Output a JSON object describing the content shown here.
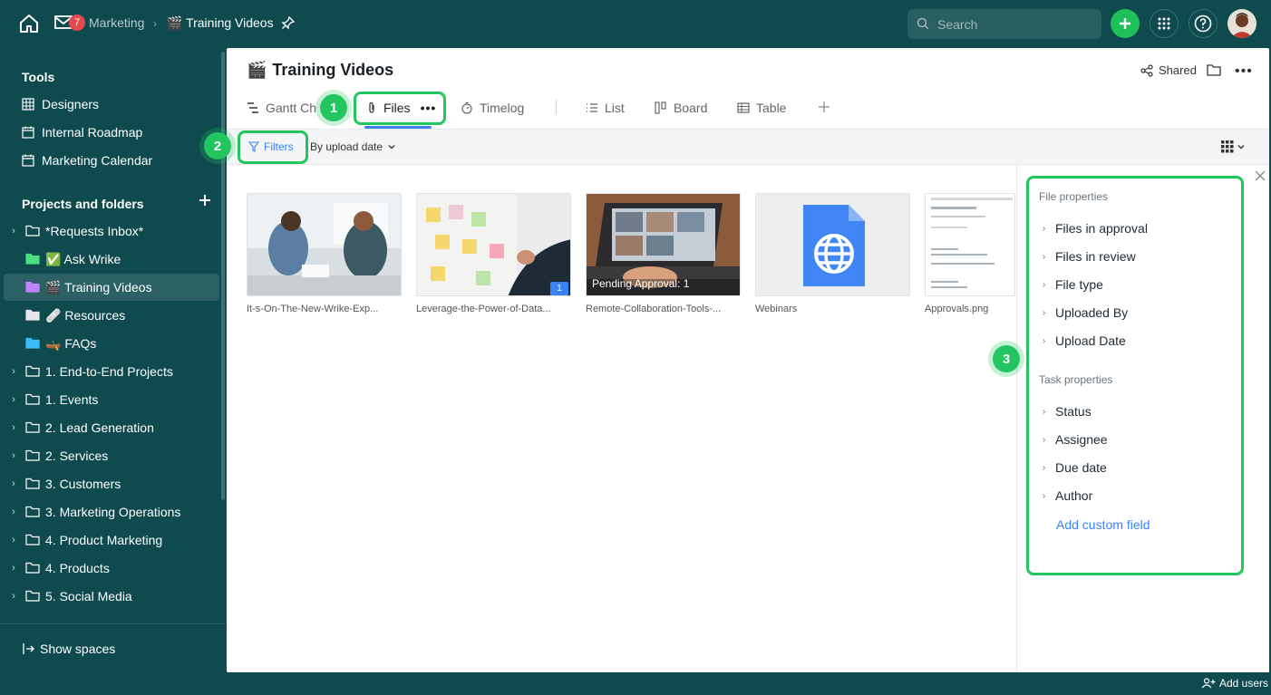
{
  "topbar": {
    "inbox_count": "7",
    "breadcrumb_parent": "Marketing",
    "breadcrumb_current_emoji": "🎬",
    "breadcrumb_current": "Training Videos",
    "search_placeholder": "Search"
  },
  "sidebar": {
    "tools_heading": "Tools",
    "tools": [
      {
        "label": "Designers",
        "icon": "grid-icon"
      },
      {
        "label": "Internal Roadmap",
        "icon": "calendar-icon"
      },
      {
        "label": "Marketing Calendar",
        "icon": "calendar-icon"
      }
    ],
    "projects_heading": "Projects and folders",
    "items": [
      {
        "label": "*Requests Inbox*",
        "expandable": true,
        "folder_color": "#ffffff"
      },
      {
        "label": "✅ Ask Wrike",
        "expandable": false,
        "folder_color": "#4ade80"
      },
      {
        "label": "🎬 Training Videos",
        "expandable": false,
        "folder_color": "#c084fc",
        "active": true
      },
      {
        "label": "🩹 Resources",
        "expandable": false,
        "folder_color": "#e5e7eb"
      },
      {
        "label": "🛶 FAQs",
        "expandable": false,
        "folder_color": "#38bdf8"
      },
      {
        "label": "1. End-to-End Projects",
        "expandable": true,
        "folder_color": "#ffffff"
      },
      {
        "label": "1. Events",
        "expandable": true,
        "folder_color": "#ffffff"
      },
      {
        "label": "2. Lead Generation",
        "expandable": true,
        "folder_color": "#ffffff"
      },
      {
        "label": "2. Services",
        "expandable": true,
        "folder_color": "#ffffff"
      },
      {
        "label": "3. Customers",
        "expandable": true,
        "folder_color": "#ffffff"
      },
      {
        "label": "3. Marketing Operations",
        "expandable": true,
        "folder_color": "#ffffff"
      },
      {
        "label": "4. Product Marketing",
        "expandable": true,
        "folder_color": "#ffffff"
      },
      {
        "label": "4. Products",
        "expandable": true,
        "folder_color": "#ffffff"
      },
      {
        "label": "5. Social Media",
        "expandable": true,
        "folder_color": "#ffffff"
      }
    ],
    "show_spaces": "Show spaces"
  },
  "page": {
    "title_emoji": "🎬",
    "title": "Training Videos",
    "shared_label": "Shared",
    "tabs": [
      {
        "label": "Gantt Ch",
        "icon": "gantt-icon"
      },
      {
        "label": "Files",
        "icon": "paperclip-icon",
        "active": true
      },
      {
        "label": "Timelog",
        "icon": "stopwatch-icon"
      },
      {
        "label": "List",
        "icon": "list-icon"
      },
      {
        "label": "Board",
        "icon": "board-icon"
      },
      {
        "label": "Table",
        "icon": "table-icon"
      }
    ],
    "filters_label": "Filters",
    "sort_label": "By upload date"
  },
  "files": [
    {
      "name": "It-s-On-The-New-Wrike-Exp..."
    },
    {
      "name": "Leverage-the-Power-of-Data...",
      "comments": "1"
    },
    {
      "name": "Remote-Collaboration-Tools-...",
      "overlay": "Pending Approval: 1"
    },
    {
      "name": "Webinars"
    },
    {
      "name": "Approvals.png"
    }
  ],
  "filter_panel": {
    "file_properties_heading": "File properties",
    "file_properties": [
      "Files in approval",
      "Files in review",
      "File type",
      "Uploaded By",
      "Upload Date"
    ],
    "task_properties_heading": "Task properties",
    "task_properties": [
      "Status",
      "Assignee",
      "Due date",
      "Author"
    ],
    "add_custom_field": "Add custom field"
  },
  "callouts": [
    "1",
    "2",
    "3"
  ],
  "footer": {
    "add_users": "Add users"
  },
  "colors": {
    "brand_dark": "#0e4a4e",
    "accent_blue": "#3b82f6",
    "accent_green": "#22c55e"
  }
}
